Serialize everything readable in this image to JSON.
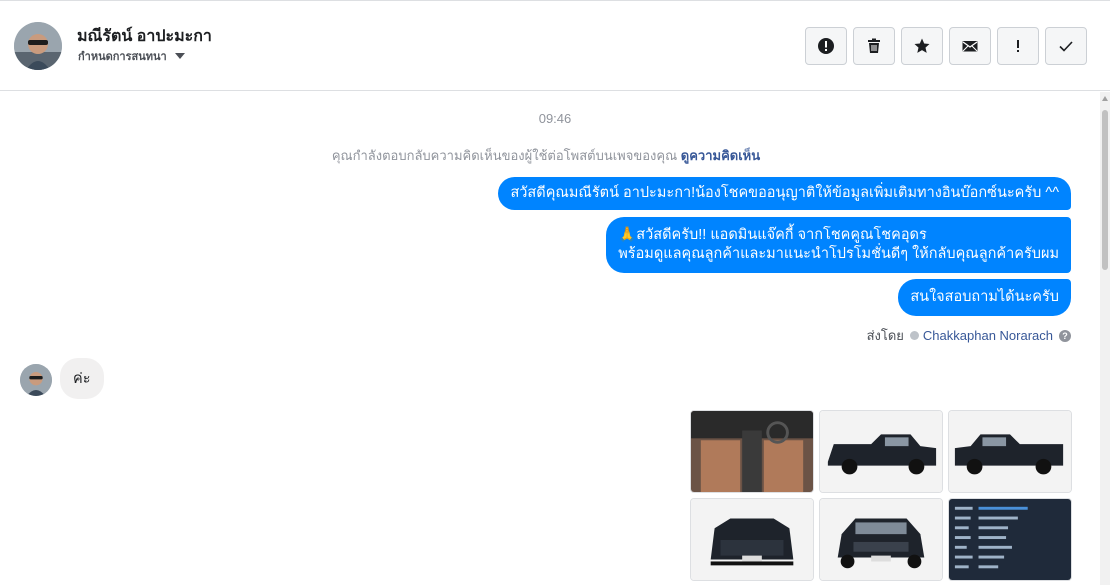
{
  "header": {
    "contact_name": "มณีรัตน์ อาปะมะกา",
    "assign_label": "กำหนดการสนทนา",
    "actions": [
      {
        "icon": "alert-circle-icon",
        "name": "mark-spam-button"
      },
      {
        "icon": "trash-icon",
        "name": "delete-button"
      },
      {
        "icon": "star-icon",
        "name": "star-button"
      },
      {
        "icon": "envelope-icon",
        "name": "mark-unread-button"
      },
      {
        "icon": "exclamation-icon",
        "name": "follow-up-button"
      },
      {
        "icon": "check-icon",
        "name": "mark-done-button"
      }
    ]
  },
  "thread": {
    "timestamp": "09:46",
    "notice_text": "คุณกำลังตอบกลับความคิดเห็นของผู้ใช้ต่อโพสต์บนเพจของคุณ",
    "notice_link": "ดูความคิดเห็น",
    "outgoing": [
      "สวัสดีคุณมณีรัตน์ อาปะมะกา!น้องโชคขออนุญาติให้ข้อมูลเพิ่มเติมทางอินบ๊อกซ์นะครับ ^^",
      "🙏สวัสดีครับ!! แอดมินแจ๊คกี้ จากโชคคูณโชคอุดร",
      "พร้อมดูแลคุณลูกค้าและมาแนะนำโปรโมชั่นดีๆ ให้กลับคุณลูกค้าครับผม",
      "สนใจสอบถามได้นะครับ"
    ],
    "sent_by_label": "ส่งโดย",
    "sent_by_name": "Chakkaphan Norarach",
    "incoming": "ค่ะ"
  },
  "gallery": {
    "photos": [
      "interior-photo",
      "truck-side-photo",
      "truck-side-photo-2",
      "truck-rear-photo",
      "truck-front-photo",
      "spec-sheet-photo"
    ]
  },
  "colors": {
    "accent": "#0084ff",
    "link": "#385898",
    "muted": "#90949c",
    "incoming_bubble": "#f1f0f0"
  }
}
